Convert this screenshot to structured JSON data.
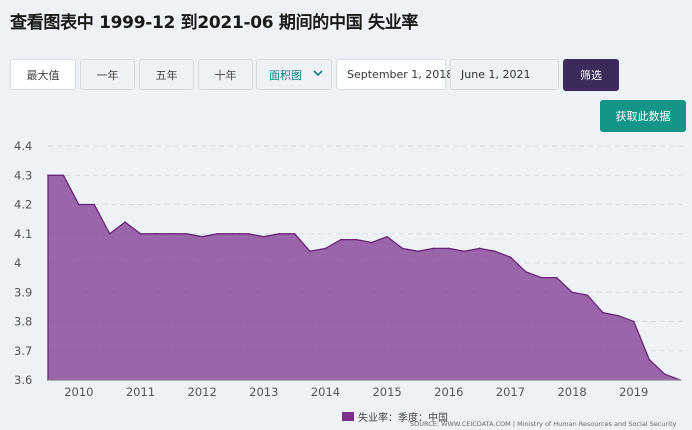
{
  "title": "查看图表中 1999-12 到2021-06 期间的中国 失业率",
  "range_buttons": [
    "最大值",
    "一年",
    "五年",
    "十年"
  ],
  "chart_type_select": "面积图",
  "date_from": "September 1, 2018",
  "date_to": "June 1, 2021",
  "filter_label": "筛选",
  "get_data_label": "获取此数据",
  "legend_label": "失业率：季度：中国",
  "source": "SOURCE: WWW.CEICDATA.COM | Ministry of Human Resources and Social Security",
  "colors": {
    "area": "#7b2e8a",
    "filter_button": "#3b2a5a",
    "get_button": "#159488"
  },
  "chart_data": {
    "type": "area",
    "ylim": [
      3.6,
      4.4
    ],
    "yticks": [
      "3.6",
      "3.7",
      "3.8",
      "3.9",
      "4",
      "4.1",
      "4.2",
      "4.3",
      "4.4"
    ],
    "xticks": [
      "2010",
      "2011",
      "2012",
      "2013",
      "2014",
      "2015",
      "2016",
      "2017",
      "2018",
      "2019"
    ],
    "grid": true,
    "legend": "bottom",
    "series": [
      {
        "name": "失业率：季度：中国",
        "x": [
          "2009-09",
          "2009-12",
          "2010-03",
          "2010-06",
          "2010-09",
          "2010-12",
          "2011-03",
          "2011-06",
          "2011-09",
          "2011-12",
          "2012-03",
          "2012-06",
          "2012-09",
          "2012-12",
          "2013-03",
          "2013-06",
          "2013-09",
          "2013-12",
          "2014-03",
          "2014-06",
          "2014-09",
          "2014-12",
          "2015-03",
          "2015-06",
          "2015-09",
          "2015-12",
          "2016-03",
          "2016-06",
          "2016-09",
          "2016-12",
          "2017-03",
          "2017-06",
          "2017-09",
          "2017-12",
          "2018-03",
          "2018-06",
          "2018-09",
          "2018-12",
          "2019-03",
          "2019-06",
          "2019-09",
          "2019-12"
        ],
        "values": [
          4.3,
          4.3,
          4.2,
          4.2,
          4.1,
          4.14,
          4.1,
          4.1,
          4.1,
          4.1,
          4.09,
          4.1,
          4.1,
          4.1,
          4.09,
          4.1,
          4.1,
          4.04,
          4.05,
          4.08,
          4.08,
          4.07,
          4.09,
          4.05,
          4.04,
          4.05,
          4.05,
          4.04,
          4.05,
          4.04,
          4.02,
          3.97,
          3.95,
          3.95,
          3.9,
          3.89,
          3.83,
          3.82,
          3.8,
          3.67,
          3.62,
          3.6
        ]
      }
    ]
  }
}
